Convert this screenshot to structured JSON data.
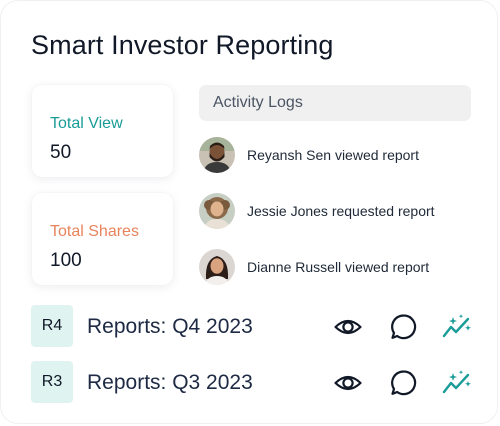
{
  "title": "Smart Investor Reporting",
  "stats": {
    "views": {
      "label": "Total View",
      "value": "50",
      "color": "#1a9c98"
    },
    "shares": {
      "label": "Total Shares",
      "value": "100",
      "color": "#e8845c"
    }
  },
  "activity": {
    "header": "Activity Logs",
    "items": [
      {
        "text": "Reyansh Sen viewed report",
        "avatar": "avatar-man-beard"
      },
      {
        "text": "Jessie Jones requested report",
        "avatar": "avatar-woman-curly"
      },
      {
        "text": "Dianne Russell viewed report",
        "avatar": "avatar-woman-dark-hair"
      }
    ]
  },
  "reports": [
    {
      "badge": "R4",
      "name": "Reports: Q4 2023"
    },
    {
      "badge": "R3",
      "name": "Reports: Q3 2023"
    }
  ],
  "colors": {
    "accent_teal": "#1a9c98",
    "accent_orange": "#e8845c",
    "badge_bg": "#dff3f1",
    "activity_header_bg": "#f1f0f1"
  },
  "icons": {
    "view": "eye-icon",
    "comment": "comment-icon",
    "insight": "sparkle-chart-icon"
  }
}
